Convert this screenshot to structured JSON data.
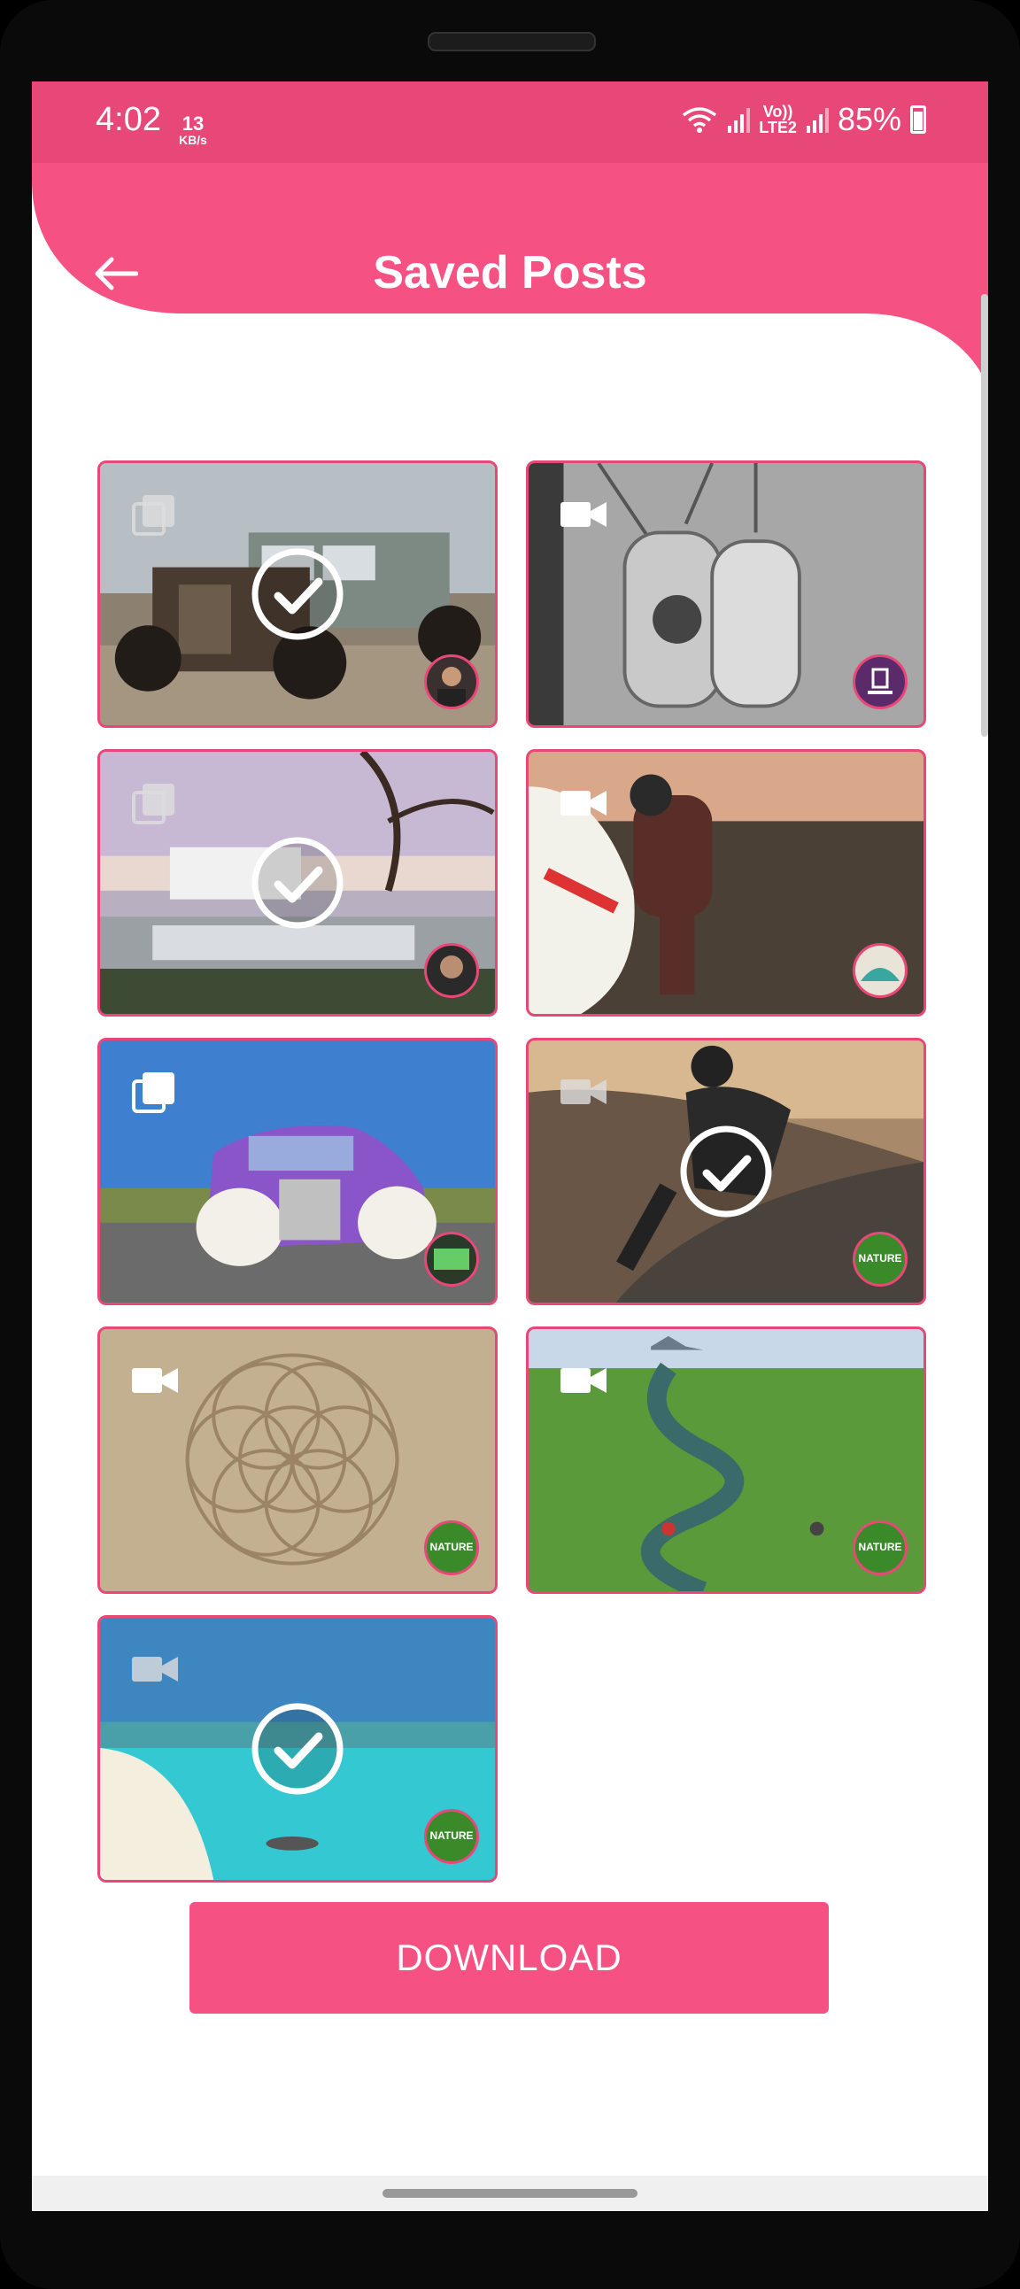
{
  "status_bar": {
    "time": "4:02",
    "speed_value": "13",
    "speed_unit": "KB/s",
    "network_label_top": "Vo))",
    "network_label_bottom": "LTE2",
    "battery": "85%"
  },
  "header": {
    "title": "Saved Posts",
    "back_icon": "arrow-left-icon"
  },
  "colors": {
    "accent": "#f55283",
    "status_bar": "#e84877",
    "border": "#e84877"
  },
  "posts": [
    {
      "type": "gallery",
      "selected": true,
      "scene": "vintage rusty car",
      "avatar_label": ""
    },
    {
      "type": "video",
      "selected": false,
      "scene": "engraved dog tag pendants",
      "avatar_label": ""
    },
    {
      "type": "gallery",
      "selected": true,
      "scene": "luxury terrace with tree",
      "avatar_label": ""
    },
    {
      "type": "video",
      "selected": false,
      "scene": "skydiver on plane",
      "avatar_label": ""
    },
    {
      "type": "gallery",
      "selected": false,
      "scene": "purple hot rod car",
      "avatar_label": ""
    },
    {
      "type": "video",
      "selected": true,
      "scene": "downhill longboarder",
      "avatar_label": "NATURE"
    },
    {
      "type": "video",
      "selected": false,
      "scene": "sand flower of life pattern",
      "avatar_label": "NATURE"
    },
    {
      "type": "video",
      "selected": false,
      "scene": "meandering green river",
      "avatar_label": "NATURE"
    },
    {
      "type": "video",
      "selected": true,
      "scene": "turquoise beach lagoon",
      "avatar_label": "NATURE"
    }
  ],
  "download_button": {
    "label": "DOWNLOAD"
  }
}
